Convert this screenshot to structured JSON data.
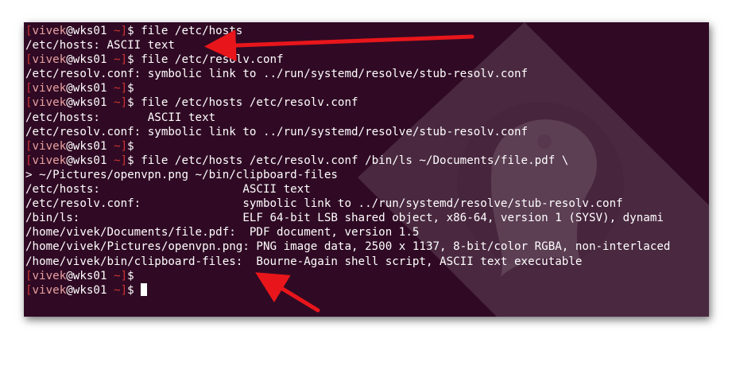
{
  "terminal": {
    "prompt": {
      "bracket_open": "[",
      "user": "vivek",
      "at": "@",
      "host": "wks01",
      "dir": " ~",
      "bracket_close": "]",
      "symbol": "$"
    },
    "lines": [
      {
        "type": "cmd",
        "text": " file /etc/hosts"
      },
      {
        "type": "out",
        "text": "/etc/hosts: ASCII text"
      },
      {
        "type": "cmd",
        "text": " file /etc/resolv.conf"
      },
      {
        "type": "out",
        "text": "/etc/resolv.conf: symbolic link to ../run/systemd/resolve/stub-resolv.conf"
      },
      {
        "type": "cmd",
        "text": ""
      },
      {
        "type": "cmd",
        "text": " file /etc/hosts /etc/resolv.conf"
      },
      {
        "type": "out",
        "text": "/etc/hosts:       ASCII text"
      },
      {
        "type": "out",
        "text": "/etc/resolv.conf: symbolic link to ../run/systemd/resolve/stub-resolv.conf"
      },
      {
        "type": "cmd",
        "text": ""
      },
      {
        "type": "cmd",
        "text": " file /etc/hosts /etc/resolv.conf /bin/ls ~/Documents/file.pdf \\"
      },
      {
        "type": "out",
        "text": "> ~/Pictures/openvpn.png ~/bin/clipboard-files"
      },
      {
        "type": "out",
        "text": "/etc/hosts:                     ASCII text"
      },
      {
        "type": "out",
        "text": "/etc/resolv.conf:               symbolic link to ../run/systemd/resolve/stub-resolv.conf"
      },
      {
        "type": "out",
        "text": "/bin/ls:                        ELF 64-bit LSB shared object, x86-64, version 1 (SYSV), dynami"
      },
      {
        "type": "out",
        "text": "/home/vivek/Documents/file.pdf:  PDF document, version 1.5"
      },
      {
        "type": "out",
        "text": "/home/vivek/Pictures/openvpn.png: PNG image data, 2500 x 1137, 8-bit/color RGBA, non-interlaced"
      },
      {
        "type": "out",
        "text": "/home/vivek/bin/clipboard-files:  Bourne-Again shell script, ASCII text executable"
      },
      {
        "type": "cmd",
        "text": ""
      },
      {
        "type": "cmd",
        "text": " ",
        "cursor": true
      }
    ]
  },
  "colors": {
    "terminal_bg": "#300a24",
    "prompt_bracket": "#cc3333",
    "prompt_user": "#e8a0a0",
    "text": "#ffffff",
    "arrow": "#e8161b"
  },
  "annotations": {
    "arrow_count": 2
  }
}
